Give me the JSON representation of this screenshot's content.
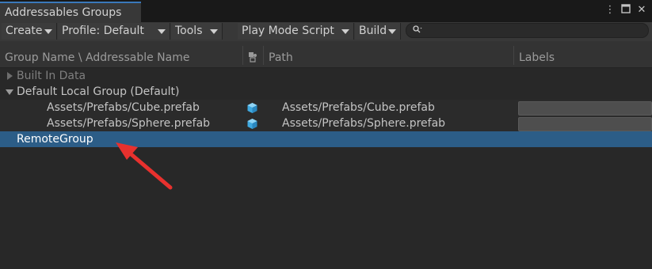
{
  "window": {
    "tab_title": "Addressables Groups",
    "icons": [
      "more-options-icon",
      "maximize-icon",
      "close-icon"
    ]
  },
  "toolbar": {
    "create": "Create",
    "profile": "Profile: Default",
    "tools": "Tools",
    "play_mode_script": "Play Mode Script",
    "build": "Build",
    "search_value": ""
  },
  "columns": {
    "name": "Group Name \\ Addressable Name",
    "path": "Path",
    "labels": "Labels"
  },
  "tree": {
    "built_in": "Built In Data",
    "default_group": "Default Local Group (Default)",
    "entries": [
      {
        "name": "Assets/Prefabs/Cube.prefab",
        "path": "Assets/Prefabs/Cube.prefab",
        "icon": "prefab-icon"
      },
      {
        "name": "Assets/Prefabs/Sphere.prefab",
        "path": "Assets/Prefabs/Sphere.prefab",
        "icon": "prefab-icon"
      }
    ],
    "remote_group": "RemoteGroup"
  },
  "colors": {
    "selection": "#2c5d87",
    "tab_accent": "#3a79bb",
    "arrow": "#e8312e",
    "prefab_icon": "#3fa9e0"
  }
}
